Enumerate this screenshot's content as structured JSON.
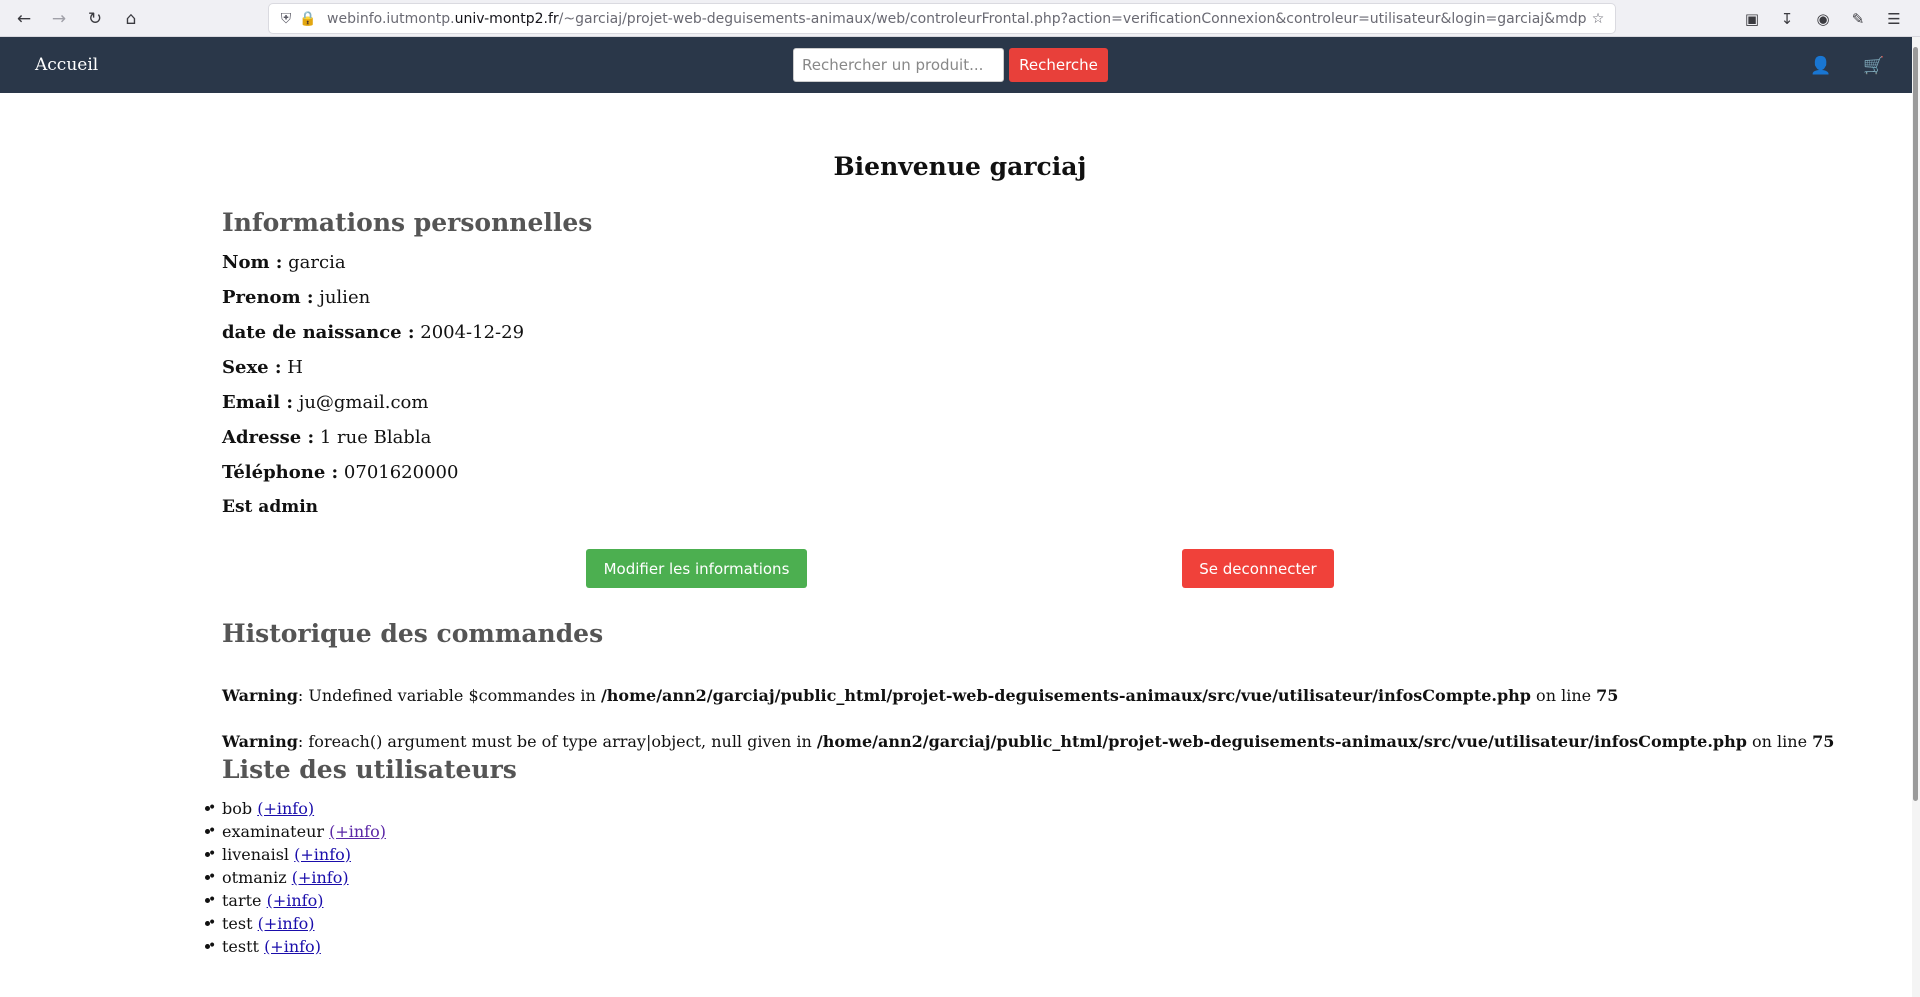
{
  "browser": {
    "url_prefix": "webinfo.iutmontp.",
    "url_domain": "univ-montp2.fr",
    "url_rest": "/~garciaj/projet-web-deguisements-animaux/web/controleurFrontal.php?action=verificationConnexion&controleur=utilisateur&login=garciaj&mdp=",
    "icons": [
      "back-icon",
      "forward-icon",
      "reload-icon",
      "home-icon",
      "shield-icon",
      "lock-icon",
      "star-icon",
      "pocket-icon",
      "download-icon",
      "account-icon",
      "extensions-icon",
      "menu-icon"
    ]
  },
  "navbar": {
    "home_label": "Accueil",
    "search_placeholder": "Rechercher un produit...",
    "search_button": "Recherche",
    "icons": [
      "user-icon",
      "cart-icon"
    ]
  },
  "welcome": "Bienvenue garciaj",
  "personal_info": {
    "title": "Informations personnelles",
    "rows": [
      {
        "label": "Nom :",
        "value": " garcia"
      },
      {
        "label": "Prenom :",
        "value": " julien"
      },
      {
        "label": "date de naissance :",
        "value": " 2004-12-29"
      },
      {
        "label": "Sexe :",
        "value": " H"
      },
      {
        "label": "Email :",
        "value": " ju@gmail.com"
      },
      {
        "label": "Adresse :",
        "value": " 1 rue Blabla"
      },
      {
        "label": "Téléphone :",
        "value": " 0701620000"
      }
    ],
    "admin_label": "Est admin"
  },
  "buttons": {
    "edit": "Modifier les informations",
    "logout": "Se deconnecter"
  },
  "orders": {
    "title": "Historique des commandes",
    "warnings": [
      {
        "tag": "Warning",
        "message": ": Undefined variable $commandes in ",
        "path": "/home/ann2/garciaj/public_html/projet-web-deguisements-animaux/src/vue/utilisateur/infosCompte.php",
        "on_line": " on line ",
        "line": "75"
      },
      {
        "tag": "Warning",
        "message": ": foreach() argument must be of type array|object, null given in ",
        "path": "/home/ann2/garciaj/public_html/projet-web-deguisements-animaux/src/vue/utilisateur/infosCompte.php",
        "on_line": " on line ",
        "line": "75"
      }
    ]
  },
  "users": {
    "title": "Liste des utilisateurs",
    "link_label": "(+info)",
    "items": [
      "bob",
      "examinateur",
      "livenaisl",
      "otmaniz",
      "tarte",
      "test",
      "testt"
    ]
  },
  "colors": {
    "navbar": "#2a3749",
    "search_button": "#e8403a",
    "edit_button": "#4caf50",
    "logout_button": "#f0413a",
    "link": "#1a0dab",
    "visited_link": "#5a26a6"
  }
}
